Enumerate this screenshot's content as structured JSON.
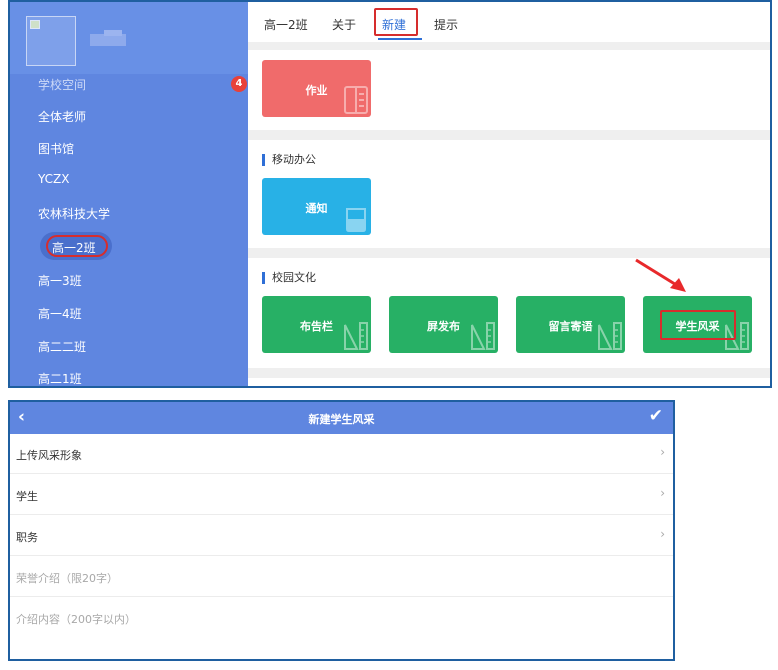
{
  "sidebar": {
    "items": [
      {
        "label": "学校空间",
        "badge": "4"
      },
      {
        "label": "全体老师"
      },
      {
        "label": "图书馆"
      },
      {
        "label": "YCZX"
      },
      {
        "label": "农林科技大学"
      },
      {
        "label": "高一2班",
        "active": true
      },
      {
        "label": "高一3班"
      },
      {
        "label": "高一4班"
      },
      {
        "label": "高二二班"
      },
      {
        "label": "高二1班"
      }
    ]
  },
  "tabs": [
    {
      "label": "高一2班"
    },
    {
      "label": "关于"
    },
    {
      "label": "新建",
      "active": true
    },
    {
      "label": "提示"
    }
  ],
  "sections": [
    {
      "title": "",
      "tiles": [
        {
          "label": "作业",
          "color": "#f06b6b",
          "icon": "notebook-icon"
        }
      ]
    },
    {
      "title": "移动办公",
      "tiles": [
        {
          "label": "通知",
          "color": "#28b1e6",
          "icon": "beaker-icon"
        }
      ]
    },
    {
      "title": "校园文化",
      "tiles": [
        {
          "label": "布告栏",
          "color": "#27b065",
          "icon": "ruler-icon"
        },
        {
          "label": "屏发布",
          "color": "#27b065",
          "icon": "ruler-icon"
        },
        {
          "label": "留言寄语",
          "color": "#27b065",
          "icon": "ruler-icon"
        },
        {
          "label": "学生风采",
          "color": "#27b065",
          "icon": "ruler-icon"
        }
      ]
    }
  ],
  "form": {
    "title": "新建学生风采",
    "back_icon": "back-arrow-icon",
    "confirm_icon": "checkmark-icon",
    "rows": [
      {
        "label": "上传风采形象",
        "chevron": "›"
      },
      {
        "label": "学生",
        "chevron": "›"
      },
      {
        "label": "职务",
        "chevron": "›"
      },
      {
        "label": "荣誉介绍（限20字）"
      },
      {
        "label": "介绍内容（200字以内）"
      }
    ]
  },
  "colors": {
    "sidebar": "#5f86e0",
    "accent": "#2f6fd6",
    "highlight": "#d62d2d"
  }
}
